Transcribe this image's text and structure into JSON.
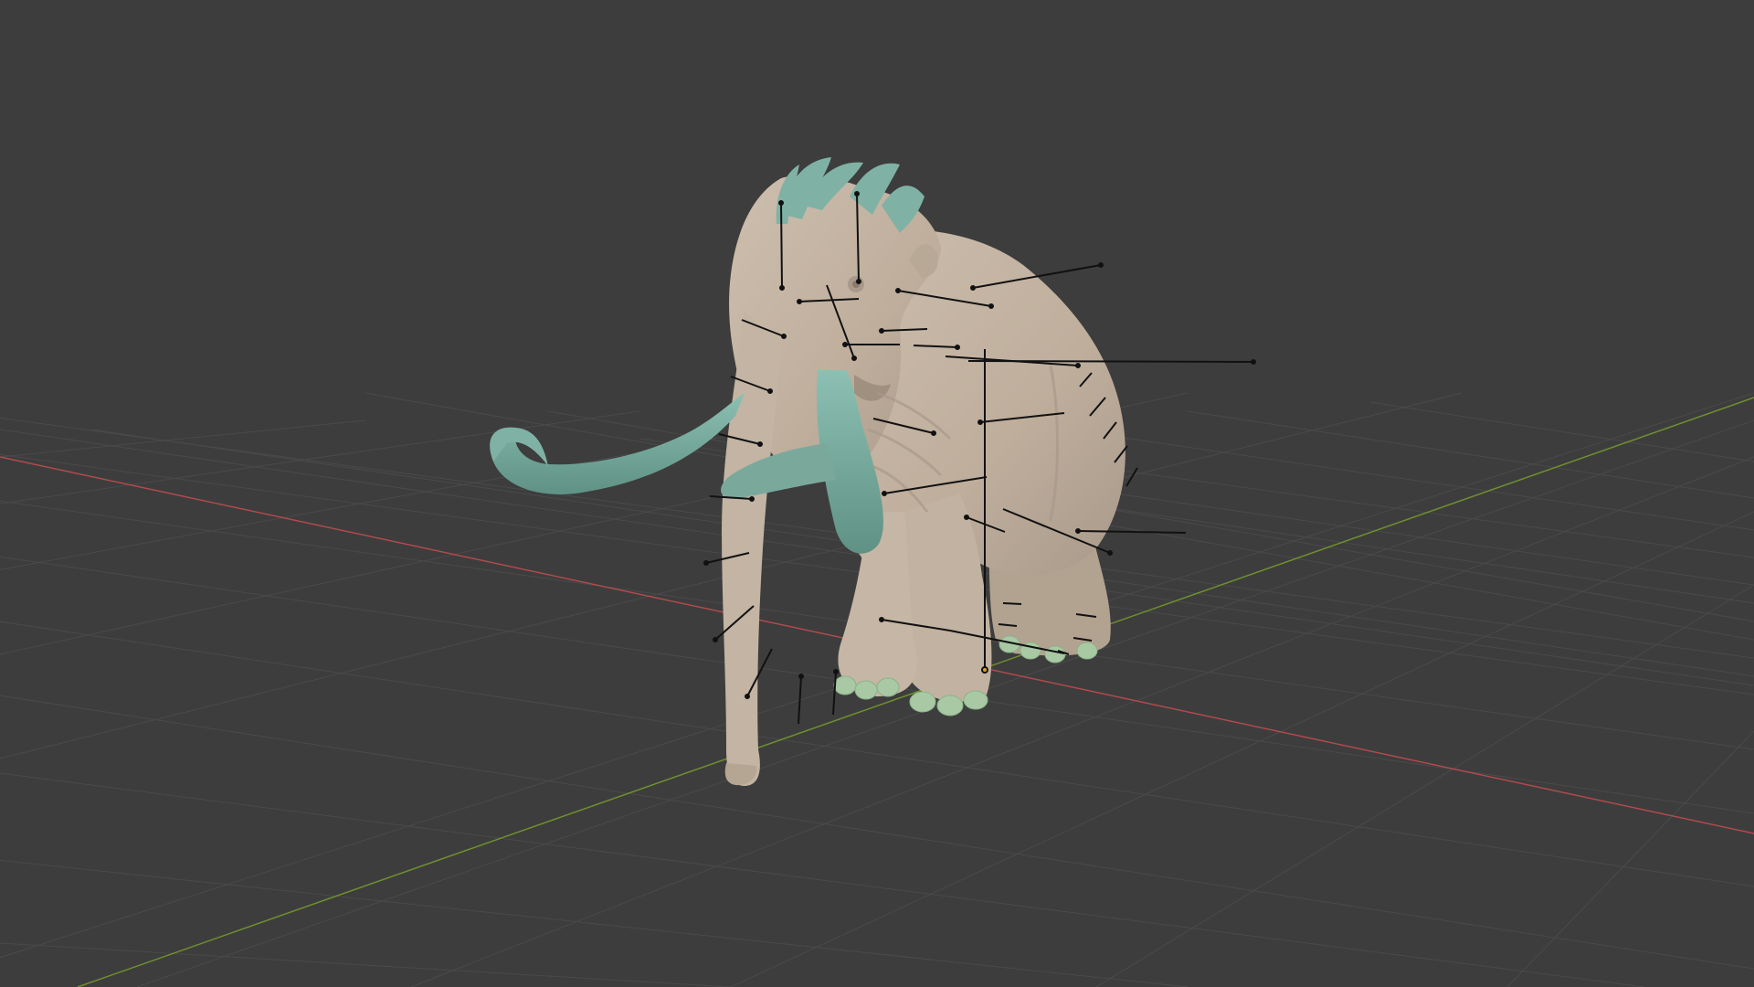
{
  "viewport": {
    "background_color": "#3d3d3d",
    "grid_color": "#4a4a4a",
    "x_axis_color": "#b14a4e",
    "y_axis_color": "#6f8f2e"
  },
  "model": {
    "body_color": "#c3b4a3",
    "body_shadow_color": "#a8998a",
    "tusk_color": "#7fb2a4",
    "tusk_shadow_color": "#5f9284",
    "hair_color": "#7fb2a4",
    "toenail_color": "#a8c9a3",
    "bone_line_color": "#111111",
    "origin_point_color": "#e0a020"
  }
}
